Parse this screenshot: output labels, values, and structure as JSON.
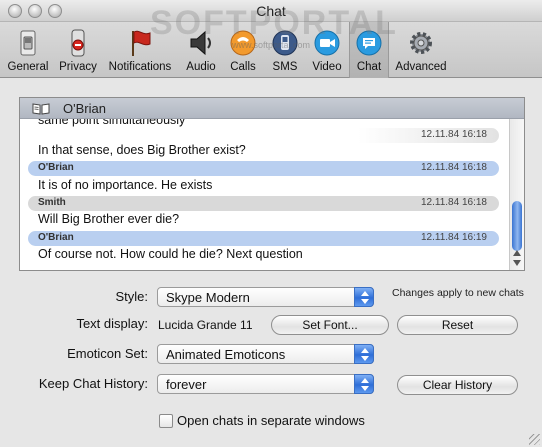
{
  "window": {
    "title": "Chat"
  },
  "watermark": {
    "text": "SOFTPORTAL",
    "sub": "www.softportal.com"
  },
  "toolbar": {
    "items": [
      {
        "label": "General",
        "icon": "switch-icon"
      },
      {
        "label": "Privacy",
        "icon": "privacy-sign-icon"
      },
      {
        "label": "Notifications",
        "icon": "red-flag-icon"
      },
      {
        "label": "Audio",
        "icon": "speaker-icon"
      },
      {
        "label": "Calls",
        "icon": "phone-icon"
      },
      {
        "label": "SMS",
        "icon": "sms-icon"
      },
      {
        "label": "Video",
        "icon": "video-camera-icon"
      },
      {
        "label": "Chat",
        "icon": "chat-bubble-icon",
        "selected": true
      },
      {
        "label": "Advanced",
        "icon": "gear-icon"
      }
    ]
  },
  "preview": {
    "contact": "O'Brian",
    "partial_text": "same point simultaneously",
    "messages": [
      {
        "author": "",
        "time": "12.11.84 16:18",
        "text": "In that sense, does Big Brother exist?"
      },
      {
        "author": "O'Brian",
        "time": "12.11.84 16:18",
        "text": "It is of no importance. He exists"
      },
      {
        "author": "Smith",
        "time": "12.11.84 16:18",
        "text": "Will Big Brother ever die?"
      },
      {
        "author": "O'Brian",
        "time": "12.11.84 16:19",
        "text": "Of course not. How could he die? Next question"
      }
    ]
  },
  "settings": {
    "style_label": "Style:",
    "style_value": "Skype Modern",
    "style_note": "Changes apply to new chats",
    "text_display_label": "Text display:",
    "text_display_value": "Lucida Grande 11",
    "set_font_label": "Set Font...",
    "reset_label": "Reset",
    "emoticon_label": "Emoticon Set:",
    "emoticon_value": "Animated Emoticons",
    "history_label": "Keep Chat History:",
    "history_value": "forever",
    "clear_history_label": "Clear History",
    "open_separate_label": "Open chats in separate windows",
    "open_separate_checked": false
  },
  "colors": {
    "accent": "#3a74d2",
    "bubble_blue": "#b9cff0",
    "bubble_gray": "#d9d9d9"
  }
}
